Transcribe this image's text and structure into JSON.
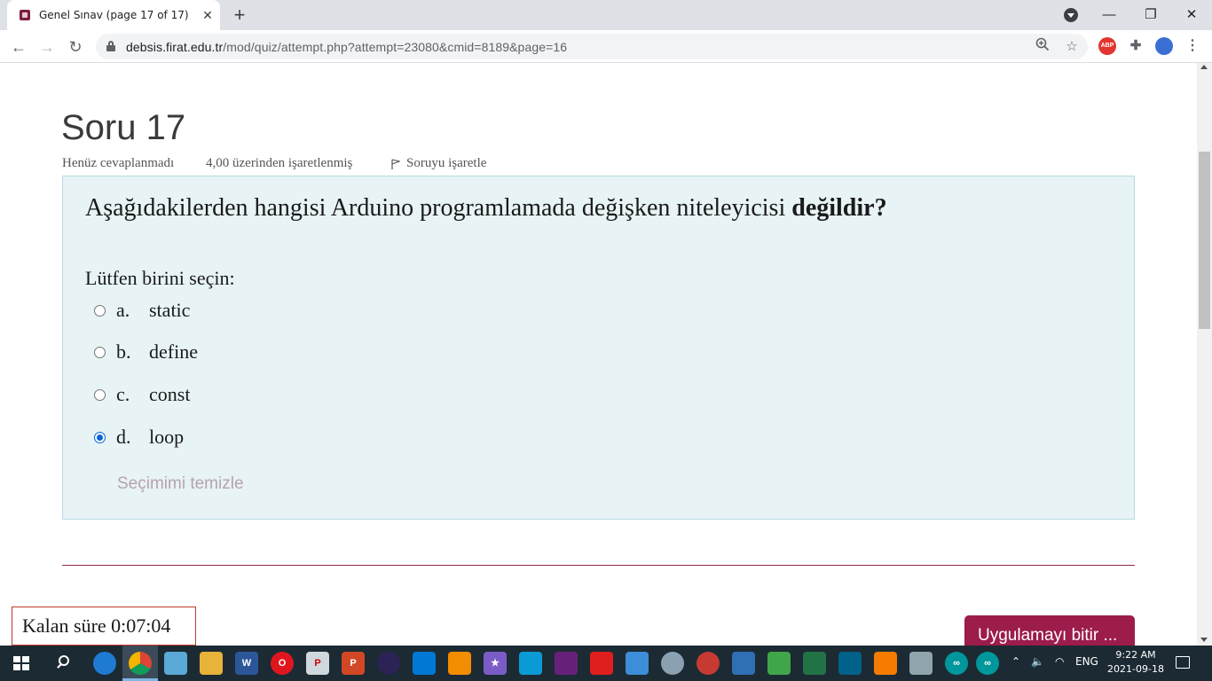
{
  "browser": {
    "tab_title": "Genel Sınav (page 17 of 17)",
    "tab_close": "✕",
    "new_tab": "+",
    "window_controls": {
      "minimize": "—",
      "restore": "❐",
      "close": "✕"
    },
    "url_host": "debsis.firat.edu.tr",
    "url_path": "/mod/quiz/attempt.php?attempt=23080&cmid=8189&page=16",
    "nav": {
      "back": "←",
      "forward": "→",
      "reload": "↻"
    },
    "extensions": {
      "abp_label": "ABP"
    }
  },
  "question": {
    "title": "Soru 17",
    "status": "Henüz cevaplanmadı",
    "marks": "4,00 üzerinden işaretlenmiş",
    "flag_label": "Soruyu işaretle",
    "text_main": "Aşağıdakilerden hangisi Arduino programlamada değişken niteleyicisi ",
    "text_bold": "değildir?",
    "prompt": "Lütfen birini seçin:",
    "options": [
      {
        "letter": "a.",
        "text": "static",
        "selected": false
      },
      {
        "letter": "b.",
        "text": "define",
        "selected": false
      },
      {
        "letter": "c.",
        "text": "const",
        "selected": false
      },
      {
        "letter": "d.",
        "text": "loop",
        "selected": true
      }
    ],
    "clear_choice": "Seçimimi temizle"
  },
  "footer": {
    "timer": "Kalan süre 0:07:04",
    "finish_button": "Uygulamayı bitir ..."
  },
  "taskbar": {
    "language": "ENG",
    "time": "9:22 AM",
    "date": "2021-09-18"
  },
  "colors": {
    "accent": "#9c1c4c",
    "question_bg": "#e7f3f5",
    "taskbar": "#1c2a33"
  }
}
